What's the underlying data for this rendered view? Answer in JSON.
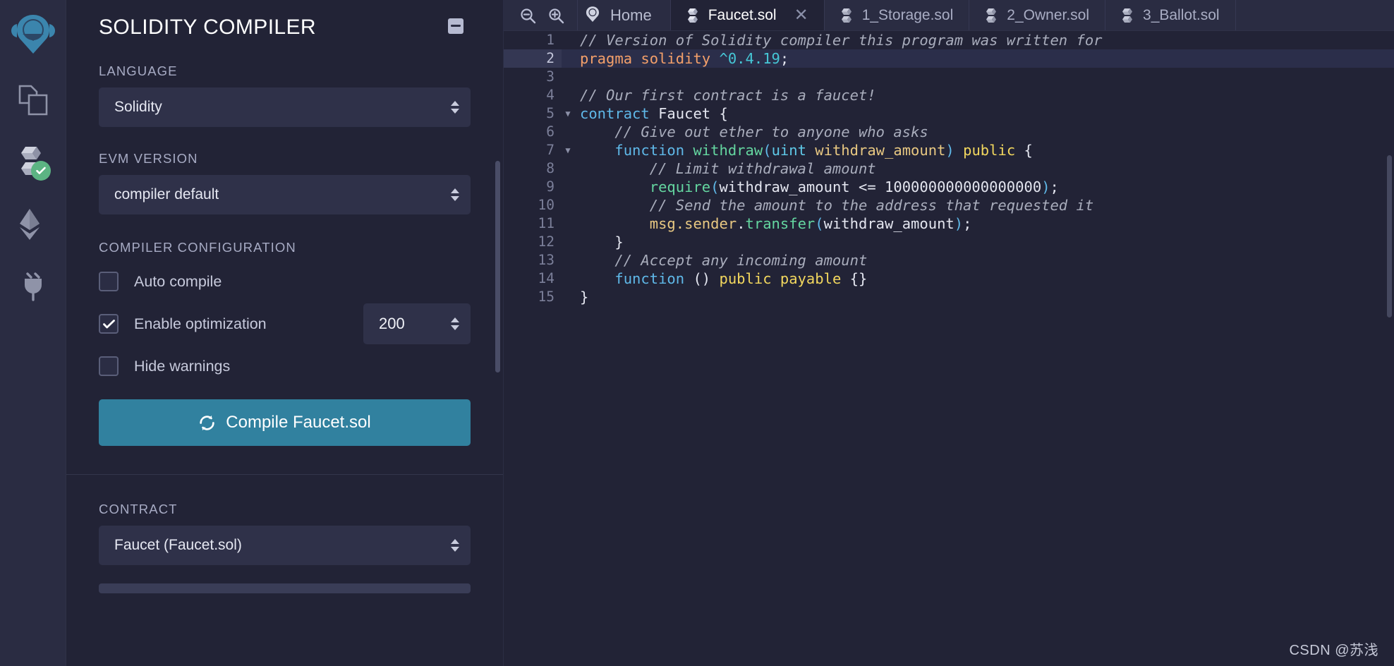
{
  "rail": {
    "items": [
      {
        "name": "remix-logo-icon",
        "label": "Remix Home"
      },
      {
        "name": "file-explorers-icon",
        "label": "File explorers"
      },
      {
        "name": "solidity-compiler-icon",
        "label": "Solidity compiler"
      },
      {
        "name": "deploy-run-icon",
        "label": "Deploy & run transactions"
      },
      {
        "name": "plugin-manager-icon",
        "label": "Plugin manager"
      }
    ]
  },
  "panel": {
    "title": "SOLIDITY COMPILER",
    "header_icon": "notes-icon",
    "language": {
      "label": "LANGUAGE",
      "value": "Solidity"
    },
    "evm": {
      "label": "EVM VERSION",
      "value": "compiler default"
    },
    "config": {
      "label": "COMPILER CONFIGURATION",
      "auto_compile": {
        "label": "Auto compile",
        "checked": false
      },
      "enable_optimization": {
        "label": "Enable optimization",
        "checked": true
      },
      "runs_value": "200",
      "hide_warnings": {
        "label": "Hide warnings",
        "checked": false
      }
    },
    "compile_button": {
      "label": "Compile Faucet.sol",
      "icon": "refresh-icon",
      "color": "#31819f"
    },
    "contract": {
      "label": "CONTRACT",
      "value": "Faucet (Faucet.sol)"
    }
  },
  "editor": {
    "tools": [
      {
        "name": "zoom-out-icon"
      },
      {
        "name": "zoom-in-icon"
      }
    ],
    "home_tab": {
      "label": "Home",
      "icon": "remix-logo-icon"
    },
    "tabs": [
      {
        "label": "Faucet.sol",
        "active": true,
        "closable": true,
        "icon": "solidity-file-icon"
      },
      {
        "label": "1_Storage.sol",
        "active": false,
        "closable": false,
        "icon": "solidity-file-icon"
      },
      {
        "label": "2_Owner.sol",
        "active": false,
        "closable": false,
        "icon": "solidity-file-icon"
      },
      {
        "label": "3_Ballot.sol",
        "active": false,
        "closable": false,
        "icon": "solidity-file-icon"
      }
    ],
    "active_line": 2,
    "lines": [
      {
        "n": 1,
        "fold": false,
        "tokens": [
          {
            "t": "// Version of Solidity compiler this program was written for",
            "c": "c-comment"
          }
        ]
      },
      {
        "n": 2,
        "fold": false,
        "tokens": [
          {
            "t": "pragma",
            "c": "c-keyorng"
          },
          {
            "t": " ",
            "c": "c-plain"
          },
          {
            "t": "solidity",
            "c": "c-keyorng"
          },
          {
            "t": " ",
            "c": "c-plain"
          },
          {
            "t": "^0.4.19",
            "c": "c-num"
          },
          {
            "t": ";",
            "c": "c-plain"
          }
        ]
      },
      {
        "n": 3,
        "fold": false,
        "tokens": []
      },
      {
        "n": 4,
        "fold": false,
        "tokens": [
          {
            "t": "// Our first contract is a faucet!",
            "c": "c-comment"
          }
        ]
      },
      {
        "n": 5,
        "fold": true,
        "tokens": [
          {
            "t": "contract",
            "c": "c-key"
          },
          {
            "t": " ",
            "c": "c-plain"
          },
          {
            "t": "Faucet",
            "c": "c-plain"
          },
          {
            "t": " {",
            "c": "c-plain"
          }
        ]
      },
      {
        "n": 6,
        "fold": false,
        "tokens": [
          {
            "t": "    // Give out ether to anyone who asks",
            "c": "c-comment"
          }
        ]
      },
      {
        "n": 7,
        "fold": true,
        "tokens": [
          {
            "t": "    ",
            "c": "c-plain"
          },
          {
            "t": "function",
            "c": "c-key"
          },
          {
            "t": " ",
            "c": "c-plain"
          },
          {
            "t": "withdraw",
            "c": "c-func"
          },
          {
            "t": "(",
            "c": "c-paren"
          },
          {
            "t": "uint",
            "c": "c-type"
          },
          {
            "t": " ",
            "c": "c-plain"
          },
          {
            "t": "withdraw_amount",
            "c": "c-var"
          },
          {
            "t": ")",
            "c": "c-paren"
          },
          {
            "t": " ",
            "c": "c-plain"
          },
          {
            "t": "public",
            "c": "c-yellow"
          },
          {
            "t": " {",
            "c": "c-plain"
          }
        ]
      },
      {
        "n": 8,
        "fold": false,
        "tokens": [
          {
            "t": "        // Limit withdrawal amount",
            "c": "c-comment"
          }
        ]
      },
      {
        "n": 9,
        "fold": false,
        "tokens": [
          {
            "t": "        ",
            "c": "c-plain"
          },
          {
            "t": "require",
            "c": "c-func"
          },
          {
            "t": "(",
            "c": "c-paren"
          },
          {
            "t": "withdraw_amount",
            "c": "c-plain"
          },
          {
            "t": " <= ",
            "c": "c-plain"
          },
          {
            "t": "100000000000000000",
            "c": "c-plain"
          },
          {
            "t": ")",
            "c": "c-paren"
          },
          {
            "t": ";",
            "c": "c-plain"
          }
        ]
      },
      {
        "n": 10,
        "fold": false,
        "tokens": [
          {
            "t": "        // Send the amount to the address that requested it",
            "c": "c-comment"
          }
        ]
      },
      {
        "n": 11,
        "fold": false,
        "tokens": [
          {
            "t": "        ",
            "c": "c-plain"
          },
          {
            "t": "msg",
            "c": "c-var"
          },
          {
            "t": ".",
            "c": "c-var"
          },
          {
            "t": "sender",
            "c": "c-var"
          },
          {
            "t": ".",
            "c": "c-plain"
          },
          {
            "t": "transfer",
            "c": "c-func"
          },
          {
            "t": "(",
            "c": "c-paren"
          },
          {
            "t": "withdraw_amount",
            "c": "c-plain"
          },
          {
            "t": ")",
            "c": "c-paren"
          },
          {
            "t": ";",
            "c": "c-plain"
          }
        ]
      },
      {
        "n": 12,
        "fold": false,
        "tokens": [
          {
            "t": "    }",
            "c": "c-plain"
          }
        ]
      },
      {
        "n": 13,
        "fold": false,
        "tokens": [
          {
            "t": "    // Accept any incoming amount",
            "c": "c-comment"
          }
        ]
      },
      {
        "n": 14,
        "fold": false,
        "tokens": [
          {
            "t": "    ",
            "c": "c-plain"
          },
          {
            "t": "function",
            "c": "c-key"
          },
          {
            "t": " ",
            "c": "c-plain"
          },
          {
            "t": "()",
            "c": "c-plain"
          },
          {
            "t": " ",
            "c": "c-plain"
          },
          {
            "t": "public",
            "c": "c-yellow"
          },
          {
            "t": " ",
            "c": "c-plain"
          },
          {
            "t": "payable",
            "c": "c-yellow"
          },
          {
            "t": " {}",
            "c": "c-plain"
          }
        ]
      },
      {
        "n": 15,
        "fold": false,
        "tokens": [
          {
            "t": "}",
            "c": "c-plain"
          }
        ]
      }
    ]
  },
  "watermark": "CSDN @苏浅"
}
